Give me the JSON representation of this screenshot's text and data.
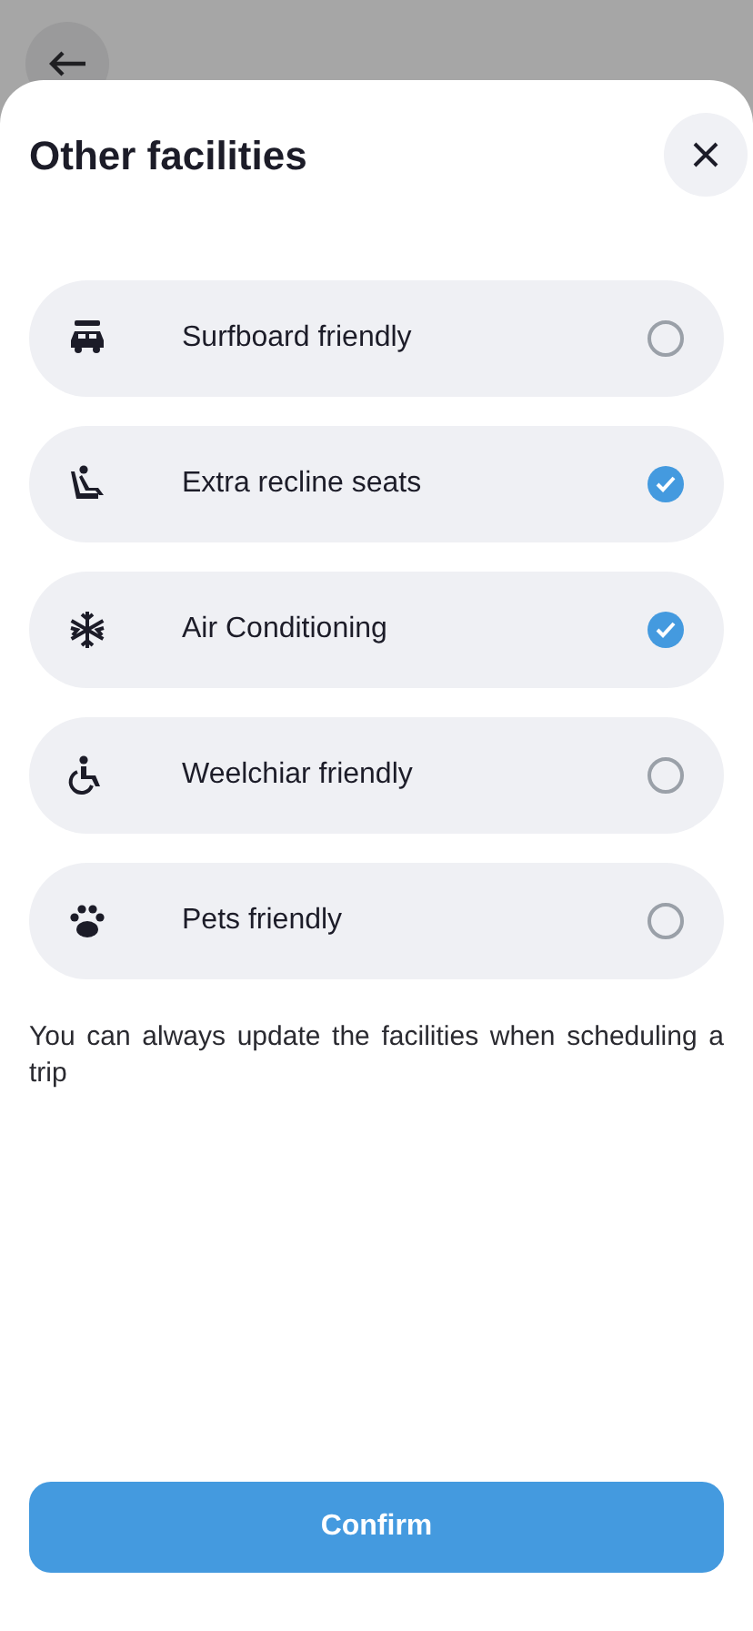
{
  "sheet": {
    "title": "Other facilities"
  },
  "facilities": [
    {
      "label": "Surfboard friendly",
      "checked": false
    },
    {
      "label": "Extra recline seats",
      "checked": true
    },
    {
      "label": "Air Conditioning",
      "checked": true
    },
    {
      "label": "Weelchiar friendly",
      "checked": false
    },
    {
      "label": "Pets friendly",
      "checked": false
    }
  ],
  "note": "You can always update the facilities when scheduling a trip",
  "confirm_button": "Confirm"
}
